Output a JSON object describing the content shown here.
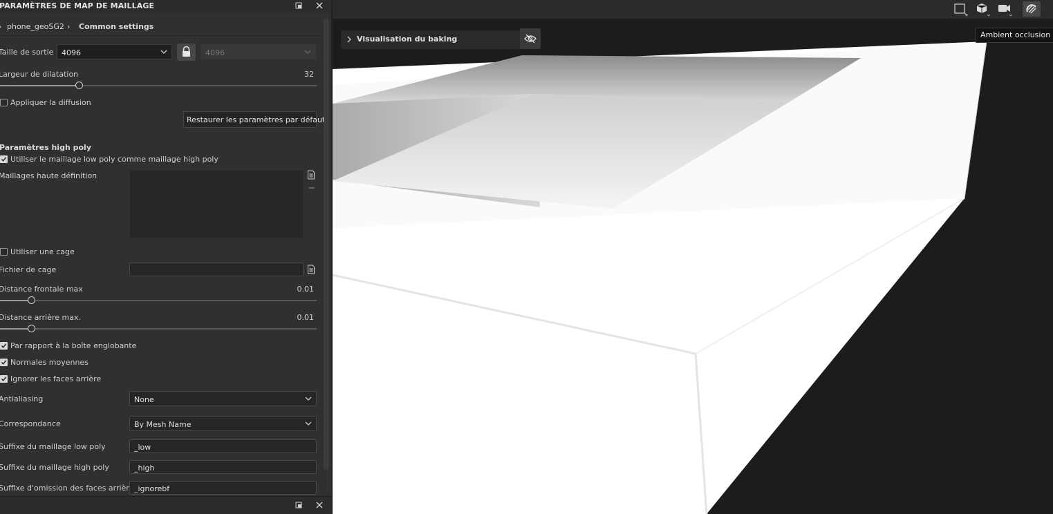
{
  "panel": {
    "title": "PARAMÈTRES DE MAP DE MAILLAGE",
    "breadcrumb": [
      "phone_geoSG2",
      "Common settings"
    ],
    "output_size": {
      "label": "Taille de sortie",
      "value": "4096",
      "linked_value": "4096"
    },
    "dilation": {
      "label": "Largeur de dilatation",
      "value": "32",
      "fraction": 0.25
    },
    "apply_diffusion": {
      "label": "Appliquer la diffusion",
      "checked": false
    },
    "reset_button": "Restaurer les paramètres par défaut",
    "high_poly_section": "Paramètres high poly",
    "use_low_as_high": {
      "label": "Utiliser le maillage low poly comme maillage high poly",
      "checked": true
    },
    "high_def_meshes_label": "Maillages haute définition",
    "use_cage": {
      "label": "Utiliser une cage",
      "checked": false
    },
    "cage_file": {
      "label": "Fichier de cage",
      "value": ""
    },
    "max_front_distance": {
      "label": "Distance frontale max",
      "value": "0.01",
      "fraction": 0.1
    },
    "max_rear_distance": {
      "label": "Distance arrière max.",
      "value": "0.01",
      "fraction": 0.1
    },
    "relative_to_bbox": {
      "label": "Par rapport à la boîte englobante",
      "checked": true
    },
    "average_normals": {
      "label": "Normales moyennes",
      "checked": true
    },
    "ignore_backfaces": {
      "label": "Ignorer les faces arrière",
      "checked": true
    },
    "antialiasing": {
      "label": "Antialiasing",
      "value": "None"
    },
    "matching": {
      "label": "Correspondance",
      "value": "By Mesh Name"
    },
    "low_poly_suffix": {
      "label": "Suffixe du maillage low poly",
      "value": "_low"
    },
    "high_poly_suffix": {
      "label": "Suffixe du maillage high poly",
      "value": "_high"
    },
    "backface_ignore_suffix": {
      "label": "Suffixe d'omission des faces arrière",
      "value": "_ignorebf"
    }
  },
  "viewport": {
    "baking_preview_label": "Visualisation du baking",
    "tooltip": "Ambient occlusion",
    "toolbar_icons": [
      "view-mode-icon",
      "mesh-display-icon",
      "camera-icon",
      "ambient-occlusion-icon"
    ]
  },
  "colors": {
    "panel_bg": "#303030",
    "viewport_bg": "#1c1c1c",
    "mesh_white": "#ffffff"
  }
}
